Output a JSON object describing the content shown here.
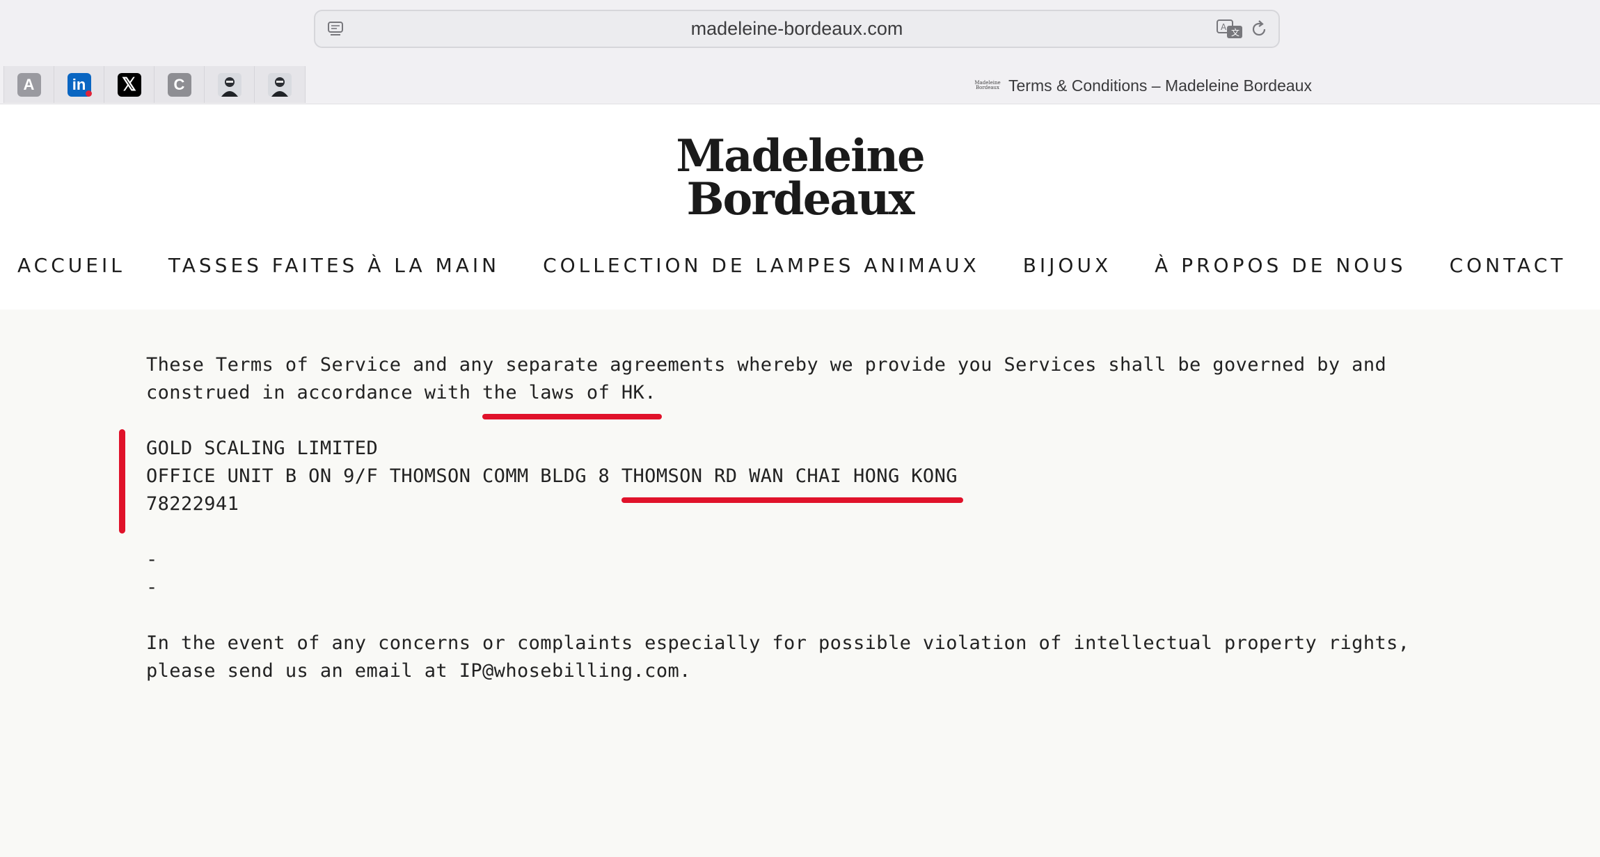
{
  "browser": {
    "url": "madeleine-bordeaux.com",
    "pinned_tabs": [
      {
        "label": "A",
        "icon": "a-letter-icon"
      },
      {
        "label": "in",
        "icon": "linkedin-icon"
      },
      {
        "label": "𝕏",
        "icon": "x-twitter-icon"
      },
      {
        "label": "C",
        "icon": "c-letter-icon"
      },
      {
        "label": "",
        "icon": "profile-photo-icon"
      },
      {
        "label": "",
        "icon": "profile-photo-icon"
      }
    ],
    "active_tab": {
      "favicon_line1": "Madeleine",
      "favicon_line2": "Bordeaux",
      "title": "Terms & Conditions – Madeleine Bordeaux"
    }
  },
  "site": {
    "logo_line1": "Madeleine",
    "logo_line2": "Bordeaux",
    "nav": [
      "ACCUEIL",
      "TASSES FAITES À LA MAIN",
      "COLLECTION DE LAMPES ANIMAUX",
      "BIJOUX",
      "À PROPOS DE NOUS",
      "CONTACT"
    ]
  },
  "content": {
    "governing_line1": "These Terms of Service and any separate agreements whereby we provide you Services shall be governed by and",
    "governing_line2_prefix": "construed in accordance with ",
    "governing_line2_highlight": "the laws of HK.",
    "company_name": "GOLD SCALING LIMITED",
    "address_prefix": "OFFICE UNIT B ON 9/F THOMSON COMM BLDG 8 ",
    "address_highlight": "THOMSON RD WAN CHAI HONG KONG",
    "company_number": "78222941",
    "dash1": "-",
    "dash2": "-",
    "ip_line1": "In the event of any concerns or complaints especially for possible violation of intellectual property rights,",
    "ip_line2": "please send us an email at IP@whosebilling.com."
  },
  "colors": {
    "annotation_red": "#e0122a",
    "page_background": "#f9f9f6"
  }
}
